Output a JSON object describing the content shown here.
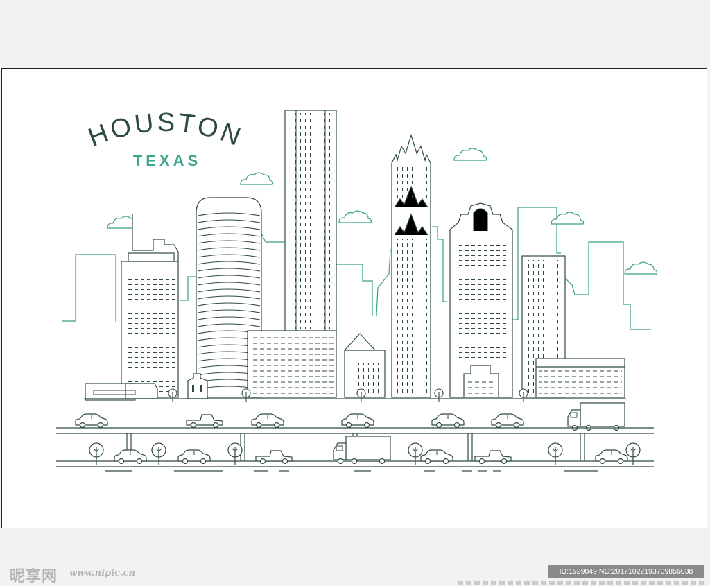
{
  "illustration": {
    "title": "HOUSTON",
    "subtitle": "TEXAS",
    "colors": {
      "line_dark": "#2f4a40",
      "line_teal": "#3aa083",
      "subtitle_color": "#3aa58c",
      "page_bg": "#f2f2f2",
      "frame_bg": "#ffffff"
    }
  },
  "watermark": {
    "logo_text": "昵享网",
    "site_url": "www.nipic.cn",
    "id_text": "ID:1529049 NO:20171022193709856038"
  }
}
